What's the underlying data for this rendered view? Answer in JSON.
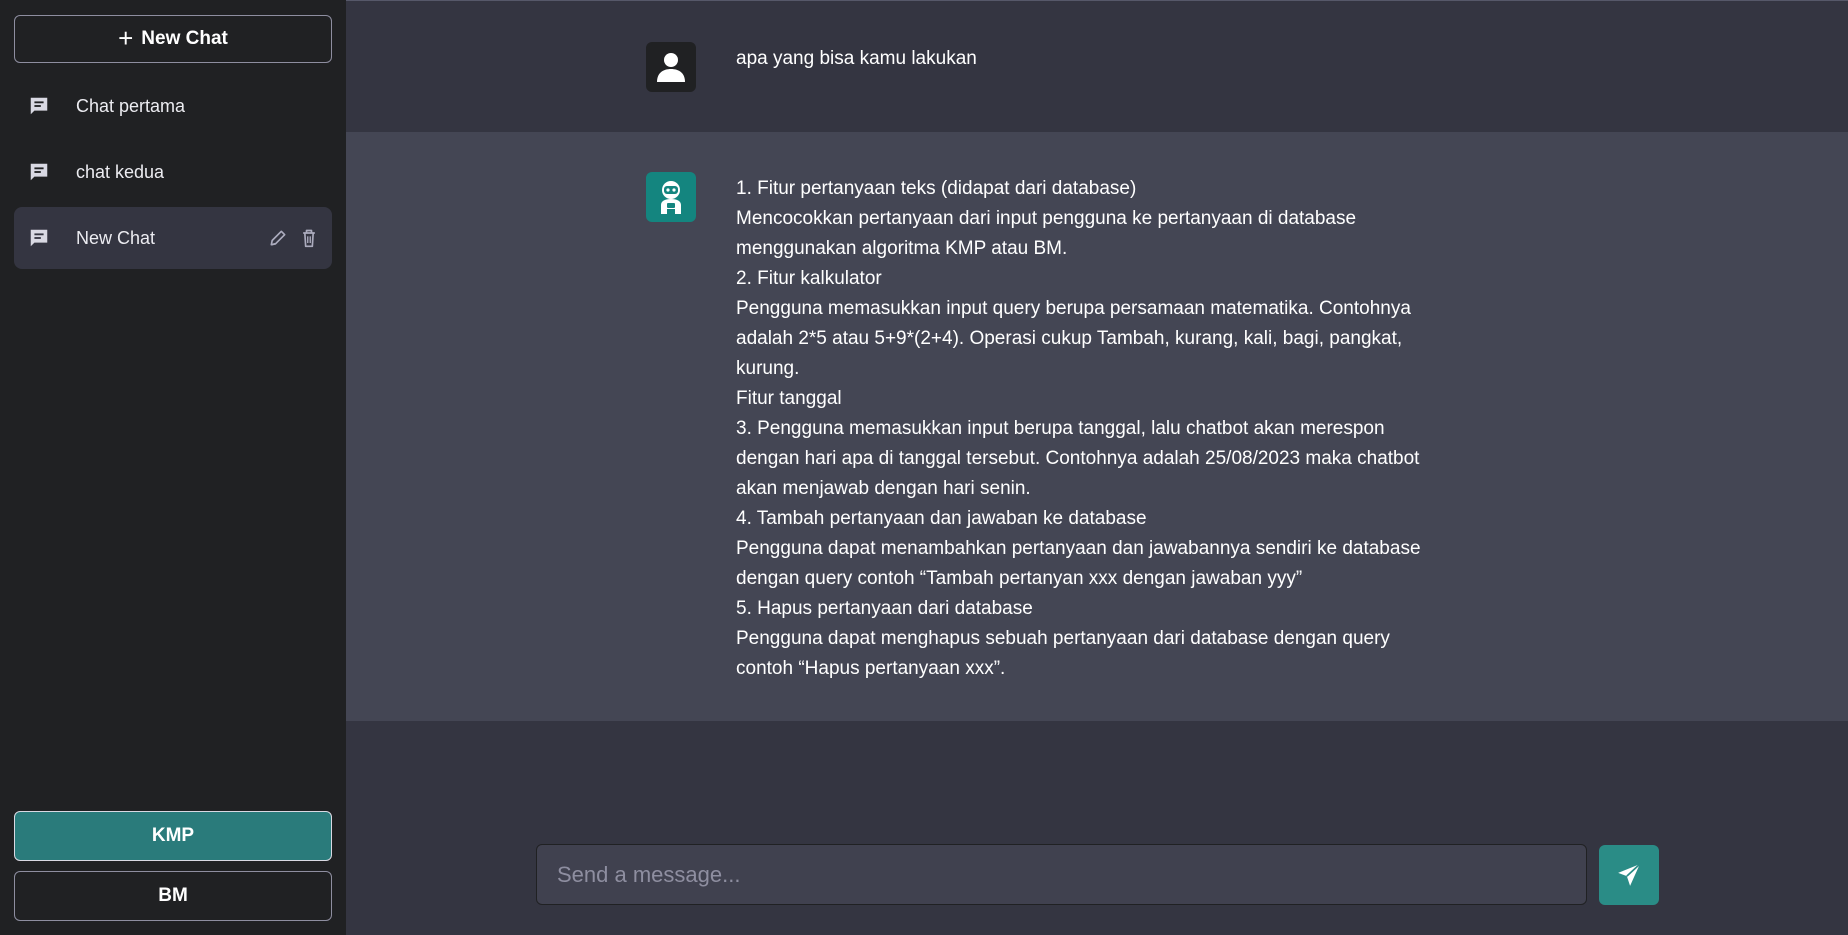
{
  "sidebar": {
    "new_chat_label": "New Chat",
    "chats": [
      {
        "label": "Chat pertama"
      },
      {
        "label": "chat kedua"
      },
      {
        "label": "New Chat"
      }
    ],
    "algorithms": [
      {
        "label": "KMP",
        "selected": true
      },
      {
        "label": "BM",
        "selected": false
      }
    ]
  },
  "conversation": {
    "user_message": "apa yang bisa kamu lakukan",
    "bot_lines": [
      "1. Fitur pertanyaan teks (didapat dari database)",
      "Mencocokkan pertanyaan dari input pengguna ke pertanyaan di database",
      "menggunakan algoritma KMP atau BM.",
      "2. Fitur kalkulator",
      "Pengguna memasukkan input query berupa persamaan matematika. Contohnya",
      "adalah 2*5 atau 5+9*(2+4). Operasi cukup Tambah, kurang, kali, bagi, pangkat,",
      "kurung.",
      "Fitur tanggal",
      "3. Pengguna memasukkan input berupa tanggal, lalu chatbot akan merespon",
      "dengan hari apa di tanggal tersebut. Contohnya adalah 25/08/2023 maka chatbot",
      "akan menjawab dengan hari senin.",
      "4. Tambah pertanyaan dan jawaban ke database",
      "Pengguna dapat menambahkan pertanyaan dan jawabannya sendiri ke database",
      "dengan query contoh “Tambah pertanyan xxx dengan jawaban yyy”",
      "5. Hapus pertanyaan dari database",
      "Pengguna dapat menghapus sebuah pertanyaan dari database dengan query",
      "contoh “Hapus pertanyaan xxx”."
    ]
  },
  "composer": {
    "placeholder": "Send a message...",
    "value": ""
  },
  "icons": {
    "chat": "message-square-icon",
    "edit": "pencil-icon",
    "delete": "trash-icon",
    "send": "paper-plane-icon",
    "user_avatar": "person-icon",
    "bot_avatar": "robot-icon"
  },
  "colors": {
    "accent": "#2a7b7b",
    "send_button": "#2a8c86",
    "bot_avatar": "#14857f",
    "sidebar_bg": "#202123",
    "main_bg": "#343541",
    "bot_msg_bg": "#444654"
  }
}
